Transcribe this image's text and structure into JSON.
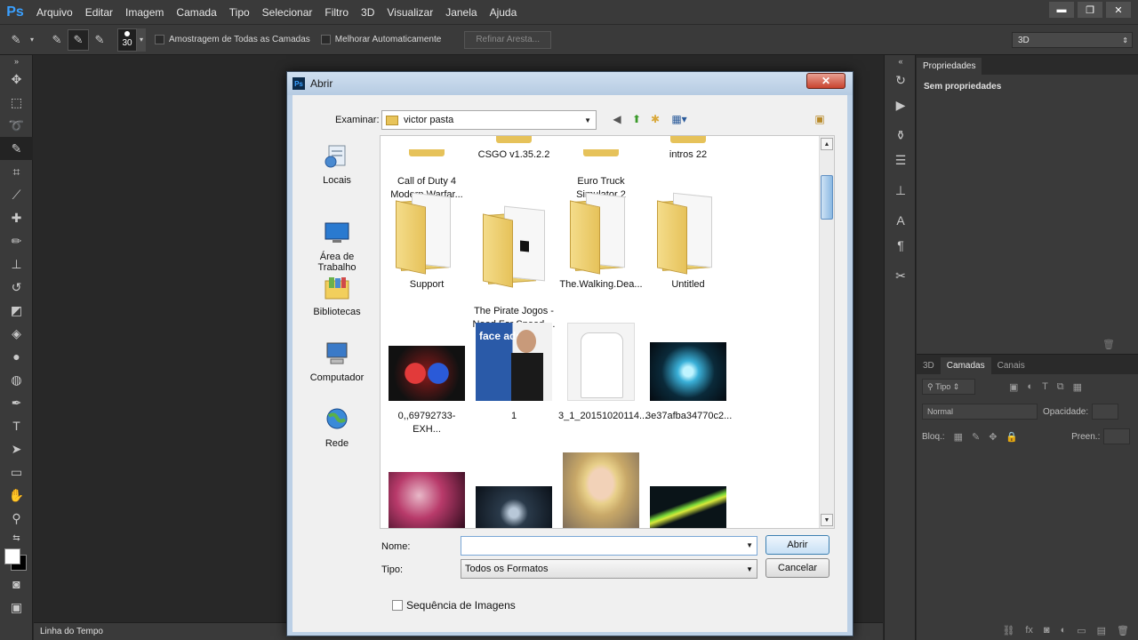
{
  "app": {
    "logo": "Ps"
  },
  "menu": [
    "Arquivo",
    "Editar",
    "Imagem",
    "Camada",
    "Tipo",
    "Selecionar",
    "Filtro",
    "3D",
    "Visualizar",
    "Janela",
    "Ajuda"
  ],
  "window_controls": {
    "minimize": "▬",
    "restore": "❐",
    "close": "✕"
  },
  "options": {
    "brush_size": "30",
    "sample_all_layers": "Amostragem de Todas as Camadas",
    "auto_enhance": "Melhorar Automaticamente",
    "refine_edge": "Refinar Aresta...",
    "workspace": "3D"
  },
  "timeline_label": "Linha do Tempo",
  "properties": {
    "tab": "Propriedades",
    "empty": "Sem propriedades"
  },
  "layers": {
    "tabs": [
      "3D",
      "Camadas",
      "Canais"
    ],
    "kind_filter": "Tipo",
    "blend_mode": "Normal",
    "opacity_label": "Opacidade:",
    "lock_label": "Bloq.:",
    "fill_label": "Preen.:"
  },
  "dialog": {
    "title": "Abrir",
    "close": "✕",
    "look_in_label": "Examinar:",
    "look_in_value": "victor pasta",
    "places": [
      "Locais",
      "Área de\nTrabalho",
      "Bibliotecas",
      "Computador",
      "Rede"
    ],
    "top_row": [
      "Call of Duty 4\nModern Warfar...",
      "CSGO v1.35.2.2",
      "Euro Truck\nSimulator 2",
      "intros 22"
    ],
    "folders": [
      "Support",
      "The Pirate Jogos -\nNeed For Speed ...",
      "The.Walking.Dea...",
      "Untitled"
    ],
    "images": [
      "0,,69792733-EXH...",
      "1",
      "3_1_20151020114...",
      "3e37afba34770c2..."
    ],
    "face_ads_text": "face ads",
    "name_label": "Nome:",
    "name_value": "",
    "type_label": "Tipo:",
    "type_value": "Todos os Formatos",
    "open_button": "Abrir",
    "cancel_button": "Cancelar",
    "image_sequence": "Sequência de Imagens"
  }
}
